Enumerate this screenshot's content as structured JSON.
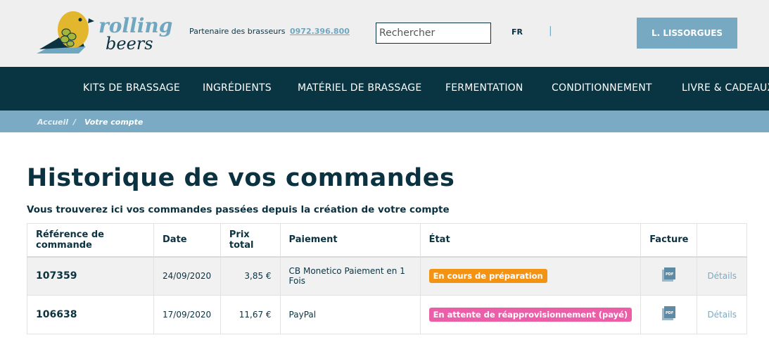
{
  "header": {
    "brand": "rolling beers",
    "partner_text": "Partenaire des brasseurs",
    "phone": "0972.396.800",
    "search_placeholder": "Rechercher",
    "lang": "FR",
    "separator": "|",
    "user_button": "L. LISSORGUES"
  },
  "nav": {
    "items": [
      "KITS DE BRASSAGE",
      "INGRÉDIENTS",
      "MATÉRIEL DE BRASSAGE",
      "FERMENTATION",
      "CONDITIONNEMENT",
      "LIVRE & CADEAUX"
    ]
  },
  "breadcrumb": {
    "home": "Accueil",
    "separator": "/",
    "current": "Votre compte"
  },
  "page": {
    "title": "Historique de vos commandes",
    "subtitle": "Vous trouverez ici vos commandes passées depuis la création de votre compte"
  },
  "table": {
    "headers": [
      "Référence de commande",
      "Date",
      "Prix total",
      "Paiement",
      "État",
      "Facture",
      ""
    ],
    "rows": [
      {
        "ref": "107359",
        "date": "24/09/2020",
        "total": "3,85 €",
        "payment": "CB Monetico Paiement en 1 Fois",
        "status": "En cours de préparation",
        "status_color": "#f39314",
        "invoice_icon": "pdf-icon",
        "details": "Détails"
      },
      {
        "ref": "106638",
        "date": "17/09/2020",
        "total": "11,67 €",
        "payment": "PayPal",
        "status": "En attente de réapprovisionnement (payé)",
        "status_color": "#ec5fa8",
        "invoice_icon": "pdf-icon",
        "details": "Détails"
      }
    ]
  },
  "colors": {
    "header_bg": "#f0efef",
    "nav_bg": "#093441",
    "breadcrumb_bg": "#7aaac4",
    "accent": "#78a9c3",
    "text": "#0b3240"
  }
}
